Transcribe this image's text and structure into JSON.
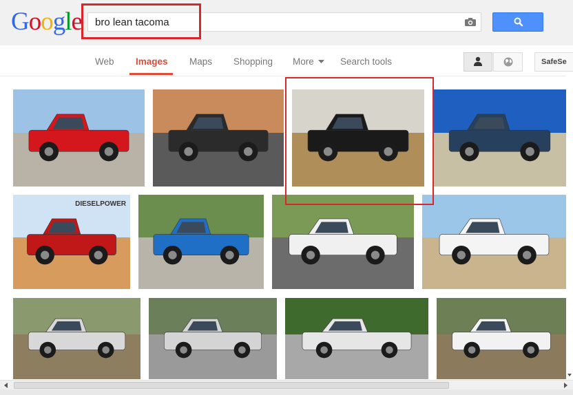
{
  "brand": {
    "letters": [
      "G",
      "o",
      "o",
      "g",
      "l",
      "e"
    ],
    "colors": [
      "#3369e8",
      "#d50f25",
      "#eeb211",
      "#3369e8",
      "#009925",
      "#d50f25"
    ]
  },
  "search": {
    "query": "bro lean tacoma"
  },
  "nav": {
    "items": [
      "Web",
      "Images",
      "Maps",
      "Shopping",
      "More",
      "Search tools"
    ],
    "active": "Images",
    "safesearch_label": "SafeSe"
  },
  "colors": {
    "accent": "#dd4b39",
    "search_button": "#4d90fe",
    "highlight_box": "#d9262b"
  },
  "icons": [
    "camera-icon",
    "search-icon",
    "person-icon",
    "globe-icon",
    "caret-down-icon",
    "scroll-arrow-left-icon",
    "scroll-arrow-right-icon",
    "scroll-arrow-down-icon"
  ],
  "results": [
    {
      "desc": "red-truck-lot",
      "truck": "#d4171c",
      "sky": "#9cc3e6",
      "ground": "#b9b2a6"
    },
    {
      "desc": "black-truck-street",
      "truck": "#2b2b2b",
      "sky": "#c98a5c",
      "ground": "#5a5a5a"
    },
    {
      "desc": "black-truck-beach",
      "truck": "#1a1a1a",
      "sky": "#d7d4cc",
      "ground": "#b08e5a"
    },
    {
      "desc": "blue-wall-bottles",
      "truck": "#27405e",
      "sky": "#1f5fbf",
      "ground": "#c8c0a4"
    },
    {
      "desc": "red-truck-dune",
      "truck": "#c01818",
      "sky": "#cfe3f5",
      "ground": "#d89b5e",
      "overlay_text": "DIESELPOWER"
    },
    {
      "desc": "blue-truck-driveway",
      "truck": "#1f6fc6",
      "sky": "#6b8e4e",
      "ground": "#b9b4aa"
    },
    {
      "desc": "white-truck-trees",
      "truck": "#f0f0f0",
      "sky": "#7a9a55",
      "ground": "#6c6c6c"
    },
    {
      "desc": "white-truck-desert",
      "truck": "#f4f4f4",
      "sky": "#9cc6e8",
      "ground": "#c9b48d"
    },
    {
      "desc": "silver-truck-garage",
      "truck": "#d8d8d8",
      "sky": "#8a9a6e",
      "ground": "#8e7e60"
    },
    {
      "desc": "silver-truck-spare",
      "truck": "#d4d4d4",
      "sky": "#6a7f5a",
      "ground": "#9a9a9a"
    },
    {
      "desc": "silver-truck-forest",
      "truck": "#e6e6e6",
      "sky": "#3f6a2e",
      "ground": "#a8a8a8"
    },
    {
      "desc": "white-trucks-dirt",
      "truck": "#f2f2f2",
      "sky": "#6d7f55",
      "ground": "#8b7a5c"
    }
  ]
}
